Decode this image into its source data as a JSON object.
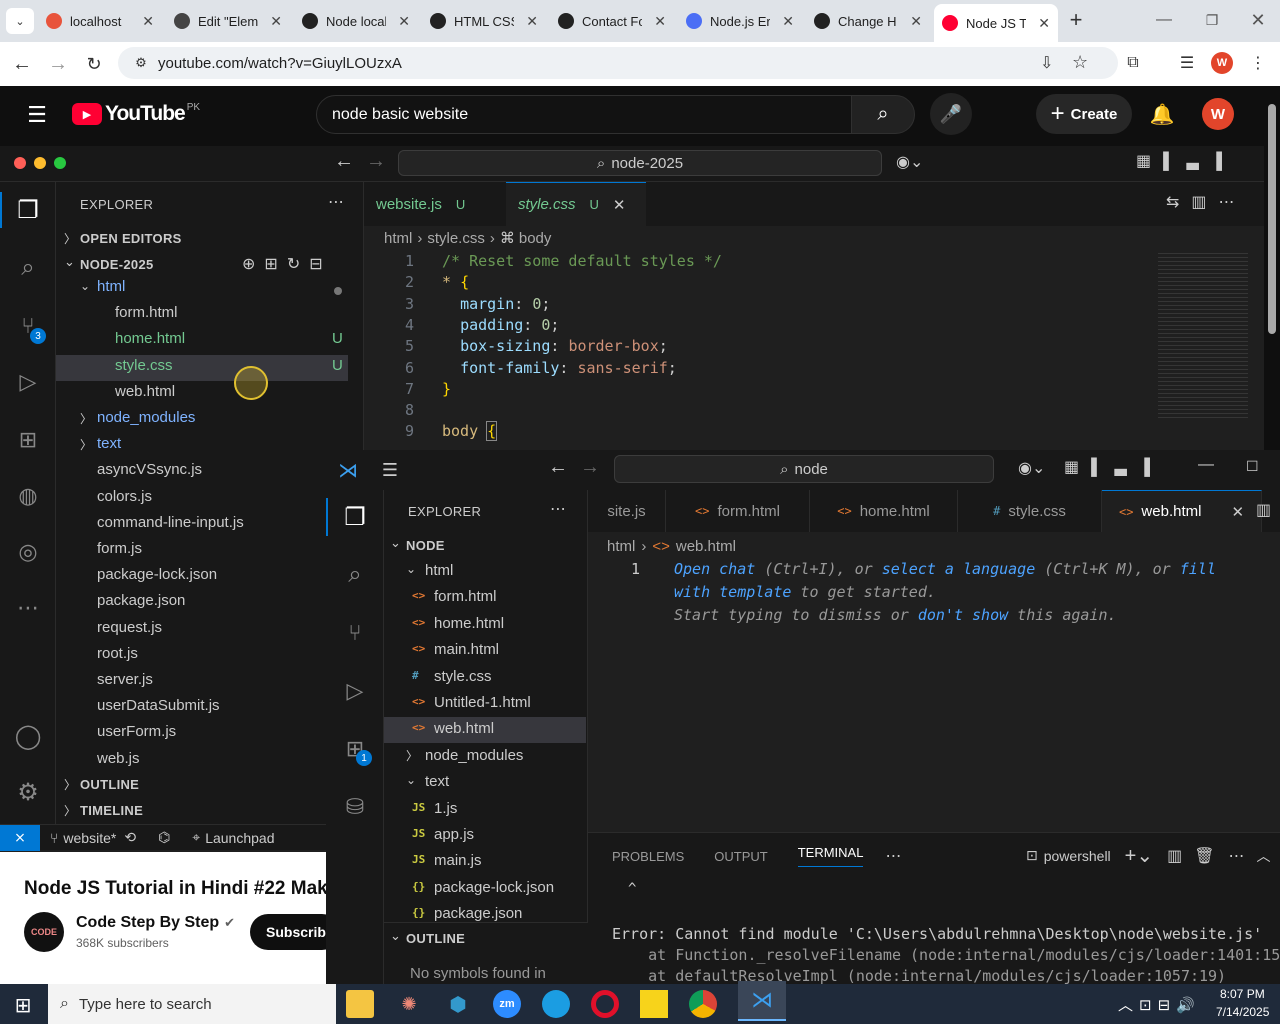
{
  "browser": {
    "tabs": [
      {
        "title": "localhost",
        "color": "#e8543c"
      },
      {
        "title": "Edit \"Elem",
        "color": "#444"
      },
      {
        "title": "Node local",
        "color": "#222"
      },
      {
        "title": "HTML CSS",
        "color": "#222"
      },
      {
        "title": "Contact Fo",
        "color": "#222"
      },
      {
        "title": "Node.js Er",
        "color": "#4b6ef5"
      },
      {
        "title": "Change H",
        "color": "#222"
      },
      {
        "title": "Node JS T",
        "color": "#ff0033"
      }
    ],
    "url": "youtube.com/watch?v=GiuylLOUzxA",
    "profile_initial": "W"
  },
  "youtube": {
    "logo": "YouTube",
    "region": "PK",
    "search_value": "node basic website",
    "create_label": "Create",
    "avatar_initial": "W",
    "video_title": "Node JS Tutorial in Hindi #22 Mak",
    "channel_name": "Code Step By Step",
    "subscribers": "368K subscribers",
    "subscribe_label": "Subscribe",
    "channel_logo_text": "CODE"
  },
  "vscode1": {
    "search": "node-2025",
    "explorer_title": "EXPLORER",
    "open_editors": "OPEN EDITORS",
    "root": "NODE-2025",
    "tree": [
      {
        "label": "html",
        "indent": 1,
        "type": "folder-open"
      },
      {
        "label": "form.html",
        "indent": 2,
        "type": "file",
        "color": "#cccccc"
      },
      {
        "label": "home.html",
        "indent": 2,
        "type": "file",
        "color": "#73c991",
        "badge": "U"
      },
      {
        "label": "style.css",
        "indent": 2,
        "type": "file",
        "color": "#73c991",
        "badge": "U",
        "selected": true
      },
      {
        "label": "web.html",
        "indent": 2,
        "type": "file",
        "color": "#cccccc"
      },
      {
        "label": "node_modules",
        "indent": 1,
        "type": "folder"
      },
      {
        "label": "text",
        "indent": 1,
        "type": "folder"
      },
      {
        "label": "asyncVSsync.js",
        "indent": 1,
        "type": "file"
      },
      {
        "label": "colors.js",
        "indent": 1,
        "type": "file"
      },
      {
        "label": "command-line-input.js",
        "indent": 1,
        "type": "file"
      },
      {
        "label": "form.js",
        "indent": 1,
        "type": "file"
      },
      {
        "label": "package-lock.json",
        "indent": 1,
        "type": "file"
      },
      {
        "label": "package.json",
        "indent": 1,
        "type": "file"
      },
      {
        "label": "request.js",
        "indent": 1,
        "type": "file"
      },
      {
        "label": "root.js",
        "indent": 1,
        "type": "file"
      },
      {
        "label": "server.js",
        "indent": 1,
        "type": "file"
      },
      {
        "label": "userDataSubmit.js",
        "indent": 1,
        "type": "file"
      },
      {
        "label": "userForm.js",
        "indent": 1,
        "type": "file"
      },
      {
        "label": "web.js",
        "indent": 1,
        "type": "file"
      }
    ],
    "outline": "OUTLINE",
    "timeline": "TIMELINE",
    "tabs": [
      {
        "label": "website.js",
        "badge": "U",
        "active": false
      },
      {
        "label": "style.css",
        "badge": "U",
        "active": true
      }
    ],
    "breadcrumb": [
      "html",
      "style.css",
      "body"
    ],
    "scm_badge": "3",
    "code": [
      {
        "n": "1",
        "text": "/* Reset some default styles */"
      },
      {
        "n": "2",
        "text": "* {"
      },
      {
        "n": "3",
        "text": "  margin: 0;"
      },
      {
        "n": "4",
        "text": "  padding: 0;"
      },
      {
        "n": "5",
        "text": "  box-sizing: border-box;"
      },
      {
        "n": "6",
        "text": "  font-family: sans-serif;"
      },
      {
        "n": "7",
        "text": "}"
      },
      {
        "n": "8",
        "text": ""
      },
      {
        "n": "9",
        "text": "body {"
      }
    ],
    "status_branch": "website*",
    "status_launchpad": "Launchpad"
  },
  "vscode2": {
    "search": "node",
    "explorer_title": "EXPLORER",
    "root": "NODE",
    "tree": [
      {
        "label": "html",
        "indent": 1,
        "type": "folder-open"
      },
      {
        "label": "form.html",
        "indent": 2,
        "icon": "<>",
        "iconColor": "#e37933"
      },
      {
        "label": "home.html",
        "indent": 2,
        "icon": "<>",
        "iconColor": "#e37933"
      },
      {
        "label": "main.html",
        "indent": 2,
        "icon": "<>",
        "iconColor": "#e37933"
      },
      {
        "label": "style.css",
        "indent": 2,
        "icon": "#",
        "iconColor": "#519aba"
      },
      {
        "label": "Untitled-1.html",
        "indent": 2,
        "icon": "<>",
        "iconColor": "#e37933"
      },
      {
        "label": "web.html",
        "indent": 2,
        "icon": "<>",
        "iconColor": "#e37933",
        "selected": true
      },
      {
        "label": "node_modules",
        "indent": 1,
        "type": "folder"
      },
      {
        "label": "text",
        "indent": 1,
        "type": "folder-open"
      },
      {
        "label": "1.js",
        "indent": 2,
        "icon": "JS",
        "iconColor": "#cbcb41"
      },
      {
        "label": "app.js",
        "indent": 2,
        "icon": "JS",
        "iconColor": "#cbcb41"
      },
      {
        "label": "main.js",
        "indent": 2,
        "icon": "JS",
        "iconColor": "#cbcb41"
      },
      {
        "label": "package-lock.json",
        "indent": 2,
        "icon": "{}",
        "iconColor": "#cbcb41"
      },
      {
        "label": "package.json",
        "indent": 2,
        "icon": "{}",
        "iconColor": "#cbcb41"
      }
    ],
    "outline": "OUTLINE",
    "no_symbols": "No symbols found in",
    "ext_badge": "1",
    "tabs": [
      {
        "label": "site.js",
        "icon": "",
        "active": false
      },
      {
        "label": "form.html",
        "icon": "<>",
        "active": false
      },
      {
        "label": "home.html",
        "icon": "<>",
        "active": false
      },
      {
        "label": "style.css",
        "icon": "#",
        "active": false
      },
      {
        "label": "web.html",
        "icon": "<>",
        "active": true
      }
    ],
    "breadcrumb": [
      "html",
      "web.html"
    ],
    "hint": {
      "line_no": "1",
      "l1a": "Open chat",
      "l1b": " (Ctrl+I), or ",
      "l1c": "select a language",
      "l1d": " (Ctrl+K M), or ",
      "l1e": "fill",
      "l2a": "with template",
      "l2b": " to get started.",
      "l3a": "Start typing to dismiss or ",
      "l3b": "don't show",
      "l3c": " this again."
    },
    "panel_tabs": [
      "PROBLEMS",
      "OUTPUT",
      "TERMINAL"
    ],
    "shell": "powershell",
    "caret": "^",
    "terminal": [
      "Error: Cannot find module 'C:\\Users\\abdulrehmna\\Desktop\\node\\website.js'",
      "    at Function._resolveFilename (node:internal/modules/cjs/loader:1401:15)",
      "    at defaultResolveImpl (node:internal/modules/cjs/loader:1057:19)"
    ]
  },
  "taskbar": {
    "search_placeholder": "Type here to search",
    "time": "8:07 PM",
    "date": "7/14/2025"
  }
}
